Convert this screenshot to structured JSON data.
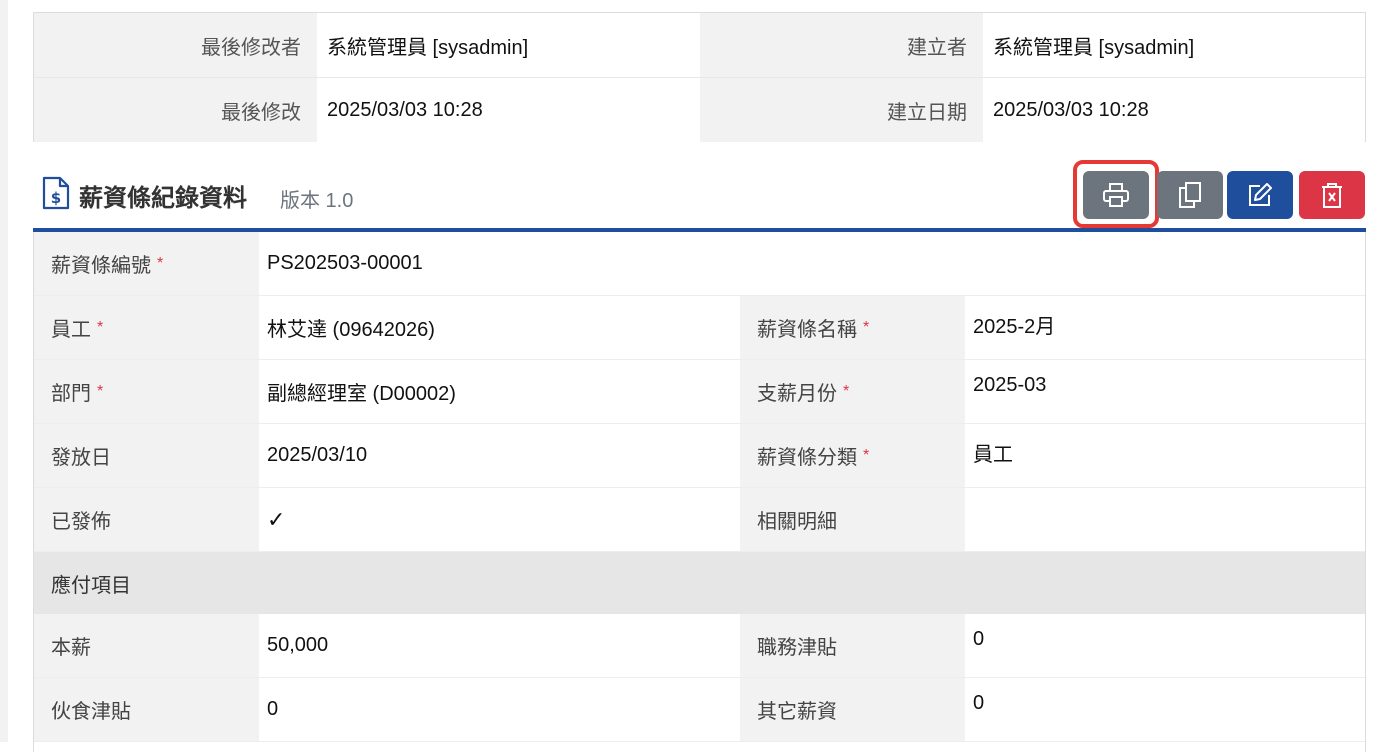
{
  "audit": {
    "modified_by_label": "最後修改者",
    "modified_by_value": "系統管理員 [sysadmin]",
    "created_by_label": "建立者",
    "created_by_value": "系統管理員 [sysadmin]",
    "modified_label": "最後修改",
    "modified_value": "2025/03/03 10:28",
    "created_date_label": "建立日期",
    "created_date_value": "2025/03/03 10:28"
  },
  "section": {
    "title": "薪資條紀錄資料",
    "version": "版本 1.0",
    "buttons": [
      "print",
      "copy",
      "edit",
      "delete"
    ]
  },
  "fields": {
    "slip_no_label": "薪資條編號",
    "slip_no": "PS202503-00001",
    "employee_label": "員工",
    "employee": "林艾達 (09642026)",
    "slip_name_label": "薪資條名稱",
    "slip_name": "2025-2月",
    "dept_label": "部門",
    "dept": "副總經理室 (D00002)",
    "pay_month_label": "支薪月份",
    "pay_month": "2025-03",
    "pay_date_label": "發放日",
    "pay_date": "2025/03/10",
    "category_label": "薪資條分類",
    "category": "員工",
    "published_label": "已發佈",
    "published_check": "✓",
    "related_label": "相關明細",
    "related": ""
  },
  "payables": {
    "group_label": "應付項目",
    "base_label": "本薪",
    "base": "50,000",
    "duty_label": "職務津貼",
    "duty": "0",
    "meal_label": "伙食津貼",
    "meal": "0",
    "other_label": "其它薪資",
    "other": "0"
  },
  "required_mark": "*",
  "colors": {
    "primary": "#1f4e9c",
    "secondary": "#6c757d",
    "danger": "#dc3545",
    "highlight": "#e53935"
  }
}
